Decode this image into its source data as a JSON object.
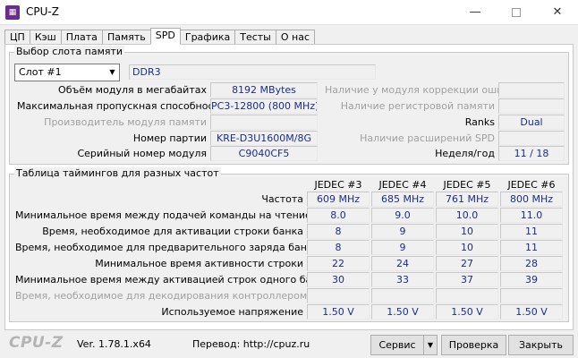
{
  "window": {
    "title": "CPU-Z",
    "icon": "cpuz-icon",
    "min": "—",
    "close": "✕"
  },
  "tabs": [
    "ЦП",
    "Кэш",
    "Плата",
    "Память",
    "SPD",
    "Графика",
    "Тесты",
    "О нас"
  ],
  "active_tab": "SPD",
  "slot": {
    "group_title": "Выбор слота памяти",
    "selected": "Слот #1",
    "type": "DDR3",
    "left_labels": {
      "module_size": "Объём модуля в мегабайтах",
      "max_bandwidth": "Максимальная пропускная способность",
      "manufacturer": "Производитель модуля памяти",
      "part_number": "Номер партии",
      "serial": "Серийный номер модуля"
    },
    "left_values": {
      "module_size": "8192 MBytes",
      "max_bandwidth": "PC3-12800 (800 MHz)",
      "manufacturer": "",
      "part_number": "KRE-D3U1600M/8G",
      "serial": "C9040CF5"
    },
    "right_labels": {
      "ecc": "Наличие у модуля коррекции ошибок",
      "registered": "Наличие регистровой памяти",
      "ranks": "Ranks",
      "spd_ext": "Наличие расширений SPD",
      "week_year": "Неделя/год"
    },
    "right_values": {
      "ecc": "",
      "registered": "",
      "ranks": "Dual",
      "spd_ext": "",
      "week_year": "11 / 18"
    }
  },
  "timings": {
    "group_title": "Таблица таймингов для разных частот",
    "columns": [
      "JEDEC #3",
      "JEDEC #4",
      "JEDEC #5",
      "JEDEC #6"
    ],
    "rows": [
      {
        "label": "Частота",
        "values": [
          "609 MHz",
          "685 MHz",
          "761 MHz",
          "800 MHz"
        ],
        "disabled": false
      },
      {
        "label": "Минимальное время между подачей команды на чтение",
        "values": [
          "8.0",
          "9.0",
          "10.0",
          "11.0"
        ],
        "disabled": false
      },
      {
        "label": "Время, необходимое для активации строки банка",
        "values": [
          "8",
          "9",
          "10",
          "11"
        ],
        "disabled": false
      },
      {
        "label": "Время, необходимое для предварительного заряда банка",
        "values": [
          "8",
          "9",
          "10",
          "11"
        ],
        "disabled": false
      },
      {
        "label": "Минимальное время активности строки",
        "values": [
          "22",
          "24",
          "27",
          "28"
        ],
        "disabled": false
      },
      {
        "label": "Минимальное время между активацией строк одного банка",
        "values": [
          "30",
          "33",
          "37",
          "39"
        ],
        "disabled": false
      },
      {
        "label": "Время, необходимое для декодирования контроллером",
        "values": [
          "",
          "",
          "",
          ""
        ],
        "disabled": true
      },
      {
        "label": "Используемое напряжение",
        "values": [
          "1.50 V",
          "1.50 V",
          "1.50 V",
          "1.50 V"
        ],
        "disabled": false
      }
    ]
  },
  "footer": {
    "logo": "CPU-Z",
    "version": "Ver. 1.78.1.x64",
    "link_text": "Перевод: http://cpuz.ru",
    "service_button": "Сервис",
    "service_arrow": "▼",
    "check_button": "Проверка",
    "close_button": "Закрыть"
  },
  "colors": {
    "value_text": "#1c2c8c",
    "disabled_text": "#a0a0a0",
    "panel": "#f0f0f0"
  }
}
